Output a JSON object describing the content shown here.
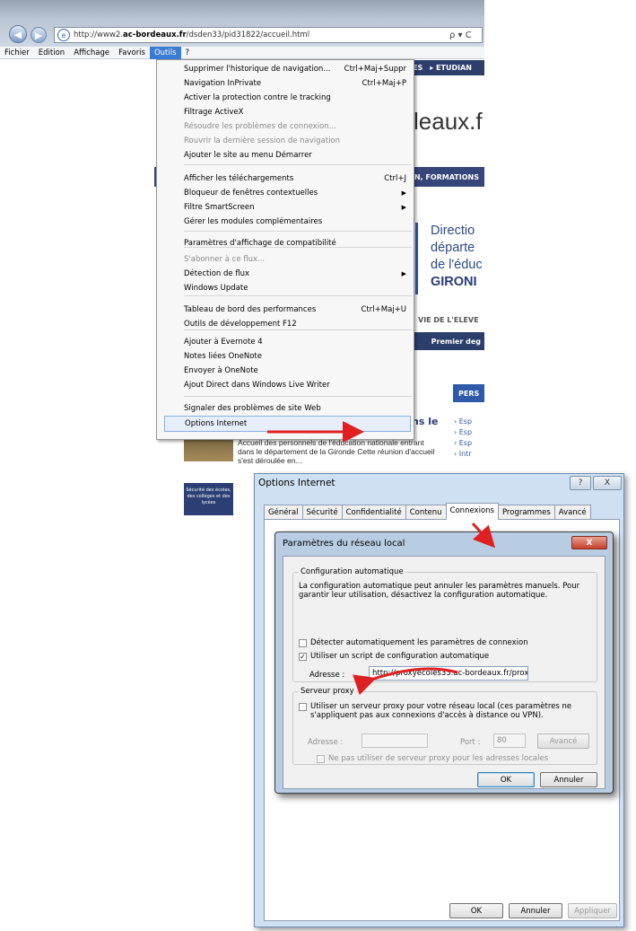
{
  "browser": {
    "url_prefix": "http://www2.",
    "url_domain": "ac-bordeaux.fr",
    "url_path": "/dsden33/pid31822/accueil.html",
    "address_tools": "ρ ▾ C",
    "menu": [
      "Fichier",
      "Edition",
      "Affichage",
      "Favoris",
      "Outils",
      "?"
    ]
  },
  "page": {
    "nav_strip": [
      "ES",
      "▸ ETUDIAN"
    ],
    "site_title": "leaux.f",
    "blue_strip": "ON, FORMATIONS",
    "direction": [
      "Directio",
      "départe",
      "de l'éduc",
      "GIRONI"
    ],
    "vie": "VIE DE L'ELEVE",
    "premier": "Premier deg",
    "pers": "PERS",
    "pers_links": [
      "› Esp",
      "› Esp",
      "› Esp",
      "› Intr"
    ],
    "ns_le": "ns le",
    "news_text": "Accueil des personnels de l'éducation nationale entrant dans le département de la Gironde Cette réunion d'accueil s'est déroulée en...",
    "secure_card": "Sécurité des écoles, des collèges et des lycées"
  },
  "tools_menu": {
    "items": [
      {
        "label": "Supprimer l'historique de navigation...",
        "shortcut": "Ctrl+Maj+Suppr",
        "disabled": false
      },
      {
        "label": "Navigation InPrivate",
        "shortcut": "Ctrl+Maj+P",
        "disabled": false
      },
      {
        "label": "Activer la protection contre le tracking",
        "shortcut": "",
        "disabled": false
      },
      {
        "label": "Filtrage ActiveX",
        "shortcut": "",
        "disabled": false
      },
      {
        "label": "Résoudre les problèmes de connexion...",
        "shortcut": "",
        "disabled": true
      },
      {
        "label": "Rouvrir la dernière session de navigation",
        "shortcut": "",
        "disabled": true
      },
      {
        "label": "Ajouter le site au menu Démarrer",
        "shortcut": "",
        "disabled": false
      },
      {
        "label": "Afficher les téléchargements",
        "shortcut": "Ctrl+J",
        "disabled": false
      },
      {
        "label": "Bloqueur de fenêtres contextuelles",
        "shortcut": "",
        "submenu": true
      },
      {
        "label": "Filtre SmartScreen",
        "shortcut": "",
        "submenu": true
      },
      {
        "label": "Gérer les modules complémentaires",
        "shortcut": ""
      },
      {
        "label": "Paramètres d'affichage de compatibilité",
        "shortcut": ""
      },
      {
        "label": "S'abonner à ce flux...",
        "shortcut": "",
        "disabled": true
      },
      {
        "label": "Détection de flux",
        "shortcut": "",
        "submenu": true
      },
      {
        "label": "Windows Update",
        "shortcut": ""
      },
      {
        "label": "Tableau de bord des performances",
        "shortcut": "Ctrl+Maj+U"
      },
      {
        "label": "Outils de développement F12",
        "shortcut": ""
      },
      {
        "label": "Ajouter à Evernote 4",
        "shortcut": ""
      },
      {
        "label": "Notes liées OneNote",
        "shortcut": ""
      },
      {
        "label": "Envoyer à OneNote",
        "shortcut": ""
      },
      {
        "label": "Ajout Direct dans Windows Live Writer",
        "shortcut": ""
      },
      {
        "label": "Signaler des problèmes de site Web",
        "shortcut": ""
      },
      {
        "label": "Options Internet",
        "shortcut": "",
        "highlighted": true
      }
    ]
  },
  "options_dialog": {
    "title": "Options Internet",
    "help": "?",
    "close": "X",
    "tabs": [
      "Général",
      "Sécurité",
      "Confidentialité",
      "Contenu",
      "Connexions",
      "Programmes",
      "Avancé"
    ],
    "selected_tab": "Connexions",
    "ok": "OK",
    "cancel": "Annuler",
    "apply": "Appliquer"
  },
  "lan_dialog": {
    "title": "Paramètres du réseau local",
    "close": "X",
    "auto_config_group": "Configuration automatique",
    "auto_config_desc": "La configuration automatique peut annuler les paramètres manuels. Pour garantir leur utilisation, désactivez la configuration automatique.",
    "detect_auto": "Détecter automatiquement les paramètres de connexion",
    "detect_auto_checked": false,
    "use_script": "Utiliser un script de configuration automatique",
    "use_script_checked": true,
    "address_label": "Adresse :",
    "address_value": "http://proxyecoles33.ac-bordeaux.fr/prox",
    "proxy_group": "Serveur proxy",
    "use_proxy": "Utiliser un serveur proxy pour votre réseau local (ces paramètres ne s'appliquent pas aux connexions d'accès à distance ou VPN).",
    "use_proxy_checked": false,
    "proxy_address_label": "Adresse :",
    "proxy_address_value": "",
    "port_label": "Port :",
    "port_value": "80",
    "advanced": "Avancé",
    "bypass_local": "Ne pas utiliser de serveur proxy pour les adresses locales",
    "ok": "OK",
    "cancel": "Annuler"
  },
  "colors": {
    "annotation_arrow": "#e02020",
    "menu_highlight": "#3a7bd5",
    "site_blue": "#2c3e6b"
  }
}
